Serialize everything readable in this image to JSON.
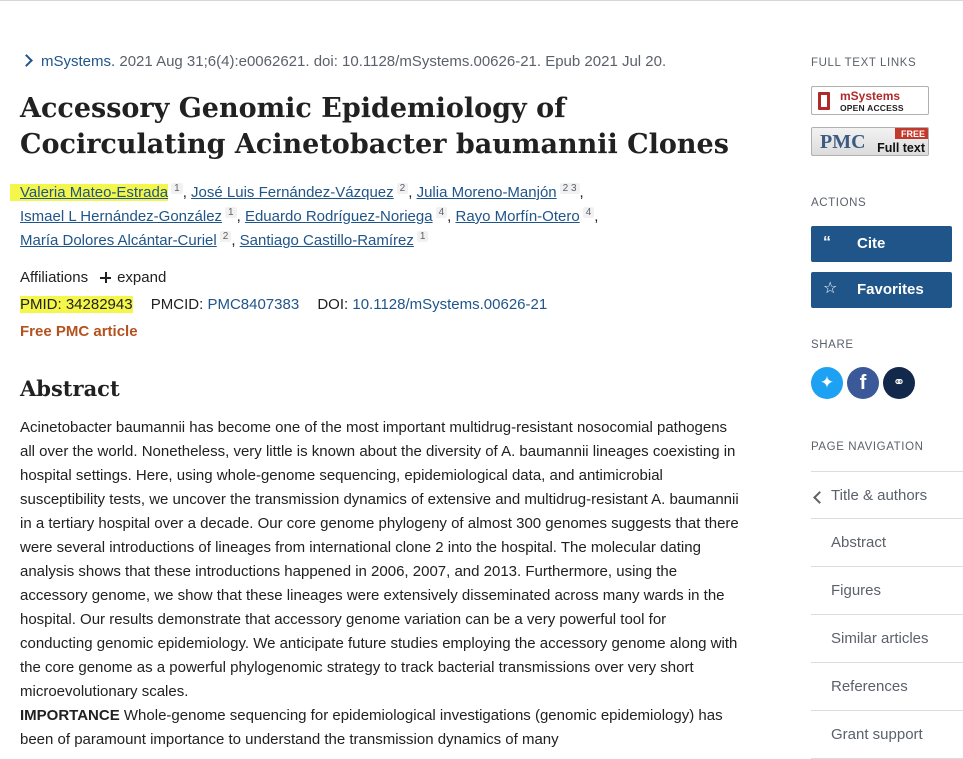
{
  "citation": {
    "journal": "mSystems.",
    "details": " 2021 Aug 31;6(4):e0062621. doi: 10.1128/mSystems.00626-21. Epub 2021 Jul 20."
  },
  "article": {
    "title": "Accessory Genomic Epidemiology of Cocirculating Acinetobacter baumannii Clones",
    "authors": [
      {
        "name": "Valeria Mateo-Estrada",
        "aff": "1"
      },
      {
        "name": "José Luis Fernández-Vázquez",
        "aff": "2"
      },
      {
        "name": "Julia Moreno-Manjón",
        "aff": "2 3"
      },
      {
        "name": "Ismael L Hernández-González",
        "aff": "1"
      },
      {
        "name": "Eduardo Rodríguez-Noriega",
        "aff": "4"
      },
      {
        "name": "Rayo Morfín-Otero",
        "aff": "4"
      },
      {
        "name": "María Dolores Alcántar-Curiel",
        "aff": "2"
      },
      {
        "name": "Santiago Castillo-Ramírez",
        "aff": "1"
      }
    ],
    "affiliations_label": "Affiliations",
    "expand_label": "expand",
    "pmid_label": "PMID:",
    "pmid": "34282943",
    "pmcid_label": "PMCID:",
    "pmcid": "PMC8407383",
    "doi_label": "DOI:",
    "doi": "10.1128/mSystems.00626-21",
    "free_label": "Free PMC article",
    "abstract_heading": "Abstract",
    "abstract_text": "Acinetobacter baumannii has become one of the most important multidrug-resistant nosocomial pathogens all over the world. Nonetheless, very little is known about the diversity of A. baumannii lineages coexisting in hospital settings. Here, using whole-genome sequencing, epidemiological data, and antimicrobial susceptibility tests, we uncover the transmission dynamics of extensive and multidrug-resistant A. baumannii in a tertiary hospital over a decade. Our core genome phylogeny of almost 300 genomes suggests that there were several introductions of lineages from international clone 2 into the hospital. The molecular dating analysis shows that these introductions happened in 2006, 2007, and 2013. Furthermore, using the accessory genome, we show that these lineages were extensively disseminated across many wards in the hospital. Our results demonstrate that accessory genome variation can be a very powerful tool for conducting genomic epidemiology. We anticipate future studies employing the accessory genome along with the core genome as a powerful phylogenomic strategy to track bacterial transmissions over very short microevolutionary scales.",
    "importance_label": "IMPORTANCE",
    "importance_text": " Whole-genome sequencing for epidemiological investigations (genomic epidemiology) has been of paramount importance to understand the transmission dynamics of many"
  },
  "sidebar": {
    "full_text_links": "FULL TEXT LINKS",
    "msystems_badge": "mSystems",
    "open_access": "OPEN ACCESS",
    "pmc_logo": "PMC",
    "pmc_free": "FREE",
    "pmc_full_text": "Full text",
    "actions": "ACTIONS",
    "cite": "Cite",
    "favorites": "Favorites",
    "share": "SHARE",
    "page_navigation": "PAGE NAVIGATION",
    "nav": [
      "Title & authors",
      "Abstract",
      "Figures",
      "Similar articles",
      "References",
      "Grant support"
    ]
  },
  "colors": {
    "link": "#20558a",
    "free_pmc": "#b4521f",
    "highlight": "#f4f64a",
    "button": "#20558a"
  }
}
